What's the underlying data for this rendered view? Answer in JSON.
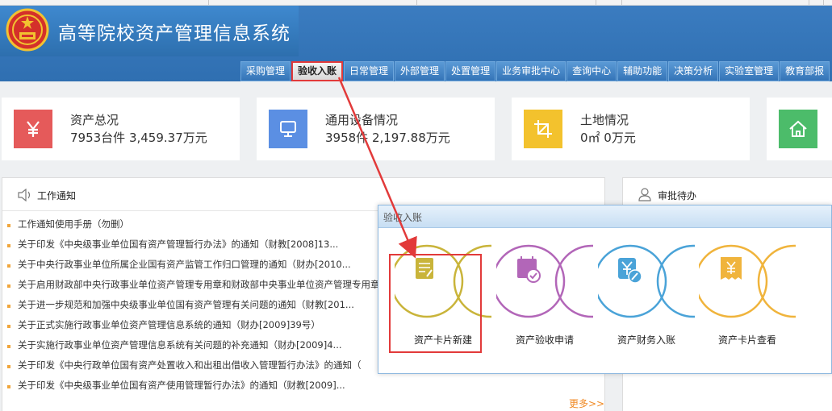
{
  "app": {
    "title": "高等院校资产管理信息系统"
  },
  "nav": {
    "items": [
      "采购管理",
      "验收入账",
      "日常管理",
      "外部管理",
      "处置管理",
      "业务审批中心",
      "查询中心",
      "辅助功能",
      "决策分析",
      "实验室管理",
      "教育部报"
    ],
    "active": "验收入账"
  },
  "cards": [
    {
      "label": "资产总况",
      "value": "7953台件 3,459.37万元",
      "icon": "yen-icon",
      "color": "#e55a5a"
    },
    {
      "label": "通用设备情况",
      "value": "3958件 2,197.88万元",
      "icon": "monitor-icon",
      "color": "#5b8fe3"
    },
    {
      "label": "土地情况",
      "value": "0㎡ 0万元",
      "icon": "crop-icon",
      "color": "#f3c22d"
    },
    {
      "label": "",
      "value": "",
      "icon": "house-icon",
      "color": "#4cbc6a"
    }
  ],
  "work_notice": {
    "title": "工作通知",
    "items": [
      "工作通知使用手册（勿删）",
      "关于印发《中央级事业单位国有资产管理暂行办法》的通知（财教[2008]13...",
      "关于中央行政事业单位所属企业国有资产监管工作归口管理的通知（财办[2010...",
      "关于启用财政部中央行政事业单位资产管理专用章和财政部中央事业单位资产管理专用章",
      "关于进一步规范和加强中央级事业单位国有资产管理有关问题的通知（财教[201...",
      "关于正式实施行政事业单位资产管理信息系统的通知（财办[2009]39号）",
      "关于实施行政事业单位资产管理信息系统有关问题的补充通知（财办[2009]4...",
      "关于印发《中央行政单位国有资产处置收入和出租出借收入管理暂行办法》的通知（",
      "关于印发《中央级事业单位国有资产使用管理暂行办法》的通知（财教[2009]..."
    ],
    "more": "更多>>"
  },
  "approval": {
    "title": "审批待办"
  },
  "modal": {
    "title": "验收入账",
    "tiles": [
      {
        "label": "资产卡片新建",
        "icon": "document-edit-icon",
        "color": "#c9b43a"
      },
      {
        "label": "资产验收申请",
        "icon": "calendar-check-icon",
        "color": "#b266b8"
      },
      {
        "label": "资产财务入账",
        "icon": "yen-pen-icon",
        "color": "#4aa3d8"
      },
      {
        "label": "资产卡片查看",
        "icon": "receipt-yen-icon",
        "color": "#f0b43c"
      }
    ]
  }
}
